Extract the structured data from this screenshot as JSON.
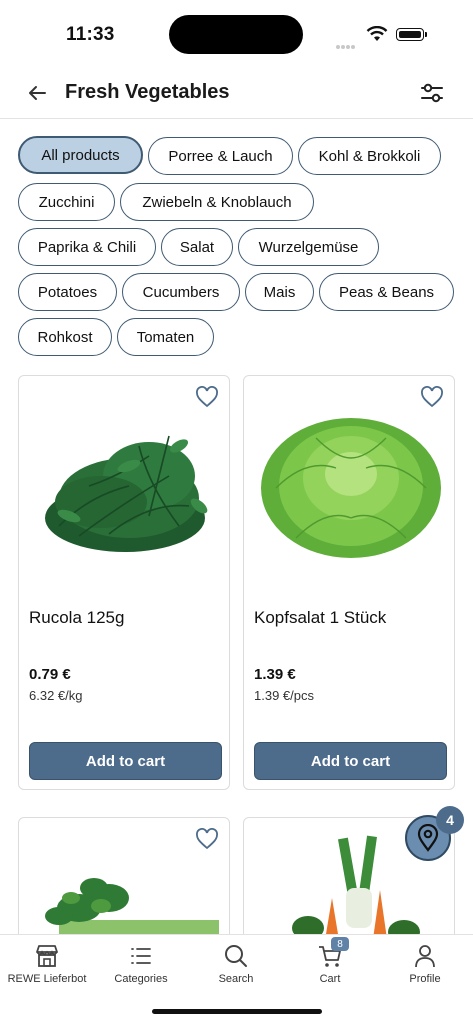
{
  "status": {
    "time": "11:33"
  },
  "header": {
    "title": "Fresh Vegetables"
  },
  "chips": [
    {
      "label": "All products",
      "active": true
    },
    {
      "label": "Porree & Lauch"
    },
    {
      "label": "Kohl & Brokkoli"
    },
    {
      "label": "Zucchini"
    },
    {
      "label": "Zwiebeln & Knoblauch"
    },
    {
      "label": "Paprika & Chili"
    },
    {
      "label": "Salat"
    },
    {
      "label": "Wurzelgemüse"
    },
    {
      "label": "Potatoes"
    },
    {
      "label": "Cucumbers"
    },
    {
      "label": "Mais"
    },
    {
      "label": "Peas & Beans"
    },
    {
      "label": "Rohkost"
    },
    {
      "label": "Tomaten"
    }
  ],
  "products": [
    {
      "name": "Rucola 125g",
      "price": "0.79 €",
      "unit_price": "6.32 €/kg",
      "button": "Add to cart"
    },
    {
      "name": "Kopfsalat 1 Stück",
      "price": "1.39 €",
      "unit_price": "1.39 €/pcs",
      "button": "Add to cart"
    }
  ],
  "fab": {
    "badge": "4"
  },
  "tabbar": {
    "items": [
      {
        "label": "REWE Lieferbot"
      },
      {
        "label": "Categories"
      },
      {
        "label": "Search"
      },
      {
        "label": "Cart"
      },
      {
        "label": "Profile"
      }
    ],
    "cart_badge": "8"
  },
  "colors": {
    "accent": "#4d6b8a",
    "chip_active": "#bcd0e4",
    "chip_border": "#3f5a73"
  }
}
